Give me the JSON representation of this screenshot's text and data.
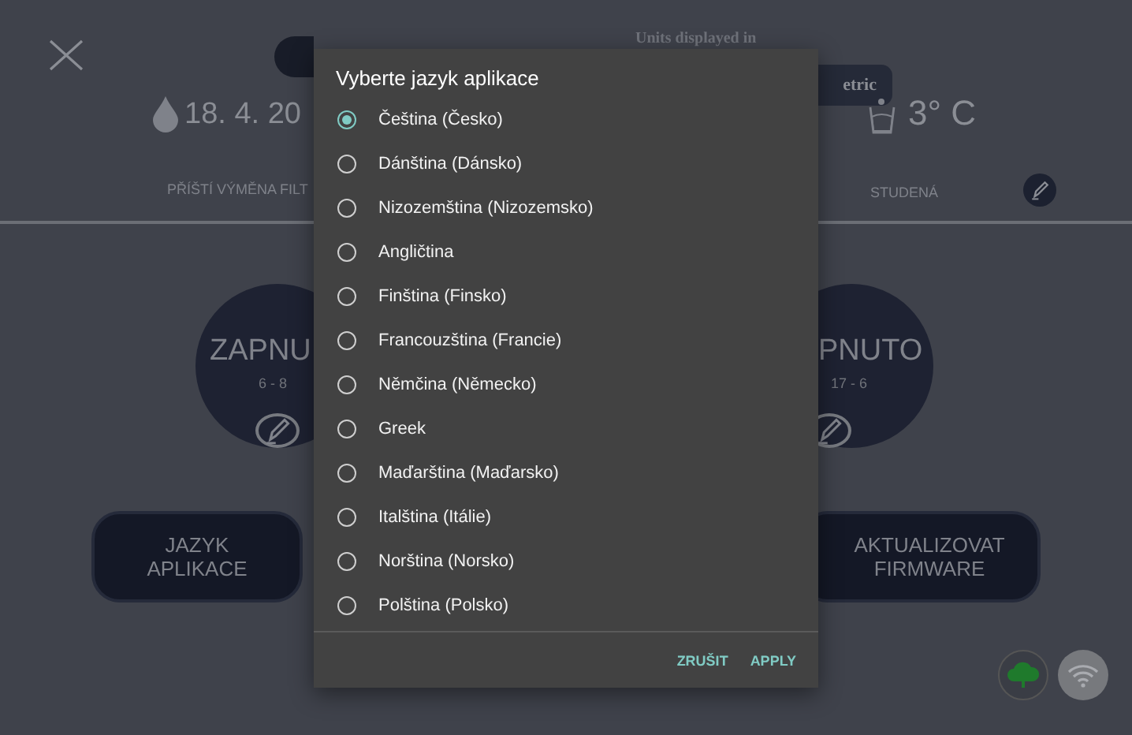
{
  "background": {
    "units_label": "Units displayed in",
    "units_button": "etric",
    "filter_date": "18. 4. 20",
    "filter_label": "PŘÍŠTÍ VÝMĚNA FILT",
    "temperature": "3° C",
    "temperature_label": "STUDENÁ",
    "schedules": [
      {
        "status": "ZAPNU",
        "hours": "6 - 8"
      },
      {
        "status": "PNUTO",
        "hours": "17 - 6"
      }
    ],
    "buttons": [
      "JAZYK APLIKACE",
      "AKTUALIZOVAT FIRMWARE"
    ]
  },
  "dialog": {
    "title": "Vyberte jazyk aplikace",
    "options": [
      {
        "label": "Čeština (Česko)",
        "selected": true
      },
      {
        "label": "Dánština (Dánsko)",
        "selected": false
      },
      {
        "label": "Nizozemština (Nizozemsko)",
        "selected": false
      },
      {
        "label": "Angličtina",
        "selected": false
      },
      {
        "label": "Finština (Finsko)",
        "selected": false
      },
      {
        "label": "Francouzština (Francie)",
        "selected": false
      },
      {
        "label": "Němčina (Německo)",
        "selected": false
      },
      {
        "label": "Greek",
        "selected": false
      },
      {
        "label": "Maďarština (Maďarsko)",
        "selected": false
      },
      {
        "label": "Italština (Itálie)",
        "selected": false
      },
      {
        "label": "Norština (Norsko)",
        "selected": false
      },
      {
        "label": "Polština (Polsko)",
        "selected": false
      }
    ],
    "actions": [
      "ZRUŠIT",
      "APPLY"
    ]
  }
}
